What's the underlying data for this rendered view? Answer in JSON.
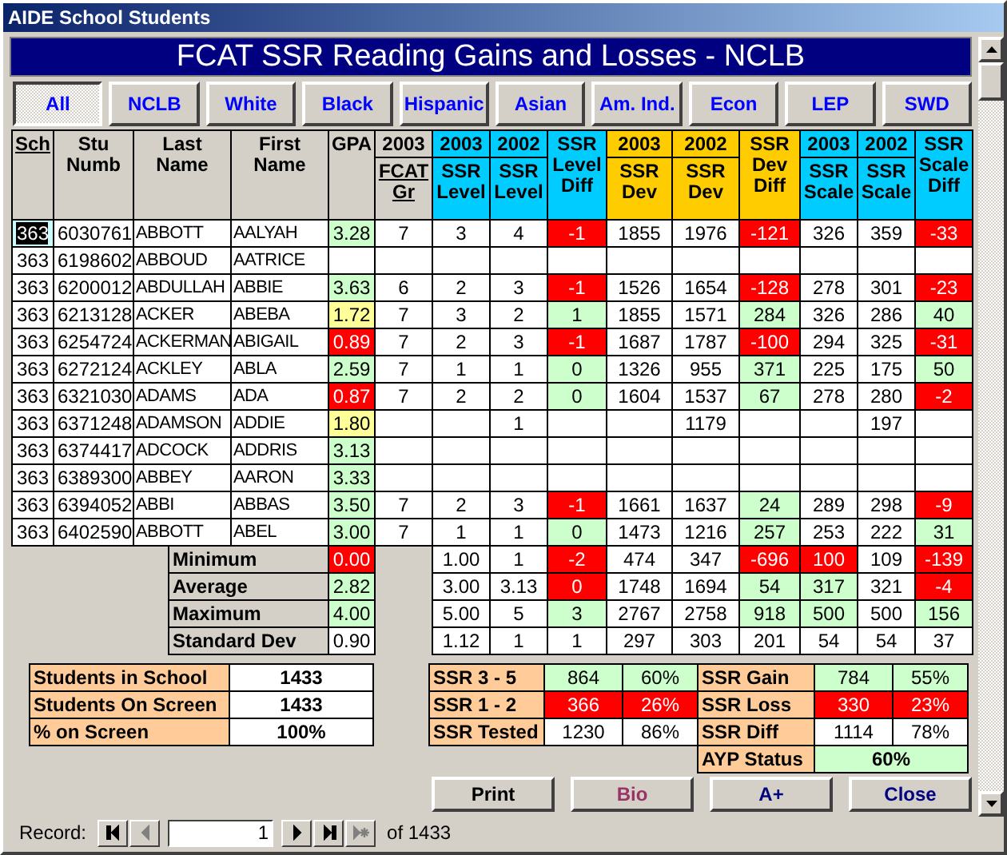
{
  "window": {
    "title": "AIDE School Students"
  },
  "banner": {
    "title": "FCAT SSR Reading Gains and Losses - NCLB"
  },
  "filters": [
    {
      "label": "All",
      "selected": true
    },
    {
      "label": "NCLB",
      "selected": false
    },
    {
      "label": "White",
      "selected": false
    },
    {
      "label": "Black",
      "selected": false
    },
    {
      "label": "Hispanic",
      "selected": false
    },
    {
      "label": "Asian",
      "selected": false
    },
    {
      "label": "Am. Ind.",
      "selected": false
    },
    {
      "label": "Econ",
      "selected": false
    },
    {
      "label": "LEP",
      "selected": false
    },
    {
      "label": "SWD",
      "selected": false
    }
  ],
  "table": {
    "columns": [
      {
        "label": "Sch",
        "color": "#d4d0c8",
        "underline": true
      },
      {
        "label": "Stu Numb",
        "color": "#d4d0c8",
        "underline": false
      },
      {
        "label": "Last Name",
        "color": "#d4d0c8",
        "underline": false
      },
      {
        "label": "First Name",
        "color": "#d4d0c8",
        "underline": false
      },
      {
        "label": "GPA",
        "color": "#d4d0c8",
        "underline": false
      },
      {
        "year": "2003",
        "label": "FCAT Gr",
        "color": "#d4d0c8",
        "underline": true
      },
      {
        "year": "2003",
        "label": "SSR Level",
        "color": "#00ccff",
        "underline": false
      },
      {
        "year": "2002",
        "label": "SSR Level",
        "color": "#00ccff",
        "underline": false
      },
      {
        "label": "SSR Level Diff",
        "color": "#00ccff",
        "underline": false
      },
      {
        "year": "2003",
        "label": "SSR Dev",
        "color": "#ffcc00",
        "underline": false
      },
      {
        "year": "2002",
        "label": "SSR Dev",
        "color": "#ffcc00",
        "underline": false
      },
      {
        "label": "SSR Dev Diff",
        "color": "#ffcc00",
        "underline": false
      },
      {
        "year": "2003",
        "label": "SSR Scale",
        "color": "#00ccff",
        "underline": false
      },
      {
        "year": "2002",
        "label": "SSR Scale",
        "color": "#00ccff",
        "underline": false
      },
      {
        "label": "SSR Scale Diff",
        "color": "#00ccff",
        "underline": false
      }
    ],
    "rows": [
      {
        "selected": true,
        "cells": [
          "363",
          "6030761",
          "ABBOTT",
          "AALYAH",
          {
            "text": "3.28",
            "color": "#ccffcc"
          },
          "7",
          "3",
          "4",
          {
            "text": "-1",
            "color": "#ff0000"
          },
          "1855",
          "1976",
          {
            "text": "-121",
            "color": "#ff0000"
          },
          "326",
          "359",
          {
            "text": "-33",
            "color": "#ff0000"
          }
        ]
      },
      {
        "selected": false,
        "cells": [
          "363",
          "6198602",
          "ABBOUD",
          "AATRICE",
          null,
          null,
          null,
          null,
          null,
          null,
          null,
          null,
          null,
          null,
          null
        ]
      },
      {
        "selected": false,
        "cells": [
          "363",
          "6200012",
          "ABDULLAH",
          "ABBIE",
          {
            "text": "3.63",
            "color": "#ccffcc"
          },
          "6",
          "2",
          "3",
          {
            "text": "-1",
            "color": "#ff0000"
          },
          "1526",
          "1654",
          {
            "text": "-128",
            "color": "#ff0000"
          },
          "278",
          "301",
          {
            "text": "-23",
            "color": "#ff0000"
          }
        ]
      },
      {
        "selected": false,
        "cells": [
          "363",
          "6213128",
          "ACKER",
          "ABEBA",
          {
            "text": "1.72",
            "color": "#ffff99"
          },
          "7",
          "3",
          "2",
          {
            "text": "1",
            "color": "#ccffcc"
          },
          "1855",
          "1571",
          {
            "text": "284",
            "color": "#ccffcc"
          },
          "326",
          "286",
          {
            "text": "40",
            "color": "#ccffcc"
          }
        ]
      },
      {
        "selected": false,
        "cells": [
          "363",
          "6254724",
          "ACKERMAN",
          "ABIGAIL",
          {
            "text": "0.89",
            "color": "#ff0000"
          },
          "7",
          "2",
          "3",
          {
            "text": "-1",
            "color": "#ff0000"
          },
          "1687",
          "1787",
          {
            "text": "-100",
            "color": "#ff0000"
          },
          "294",
          "325",
          {
            "text": "-31",
            "color": "#ff0000"
          }
        ]
      },
      {
        "selected": false,
        "cells": [
          "363",
          "6272124",
          "ACKLEY",
          "ABLA",
          {
            "text": "2.59",
            "color": "#ccffcc"
          },
          "7",
          "1",
          "1",
          {
            "text": "0",
            "color": "#ccffcc"
          },
          "1326",
          "955",
          {
            "text": "371",
            "color": "#ccffcc"
          },
          "225",
          "175",
          {
            "text": "50",
            "color": "#ccffcc"
          }
        ]
      },
      {
        "selected": false,
        "cells": [
          "363",
          "6321030",
          "ADAMS",
          "ADA",
          {
            "text": "0.87",
            "color": "#ff0000"
          },
          "7",
          "2",
          "2",
          {
            "text": "0",
            "color": "#ccffcc"
          },
          "1604",
          "1537",
          {
            "text": "67",
            "color": "#ccffcc"
          },
          "278",
          "280",
          {
            "text": "-2",
            "color": "#ff0000"
          }
        ]
      },
      {
        "selected": false,
        "cells": [
          "363",
          "6371248",
          "ADAMSON",
          "ADDIE",
          {
            "text": "1.80",
            "color": "#ffff99"
          },
          null,
          null,
          "1",
          null,
          null,
          "1179",
          null,
          null,
          "197",
          null
        ]
      },
      {
        "selected": false,
        "cells": [
          "363",
          "6374417",
          "ADCOCK",
          "ADDRIS",
          {
            "text": "3.13",
            "color": "#ccffcc"
          },
          null,
          null,
          null,
          null,
          null,
          null,
          null,
          null,
          null,
          null
        ]
      },
      {
        "selected": false,
        "cells": [
          "363",
          "6389300",
          "ABBEY",
          "AARON",
          {
            "text": "3.33",
            "color": "#ccffcc"
          },
          null,
          null,
          null,
          null,
          null,
          null,
          null,
          null,
          null,
          null
        ]
      },
      {
        "selected": false,
        "cells": [
          "363",
          "6394052",
          "ABBI",
          "ABBAS",
          {
            "text": "3.50",
            "color": "#ccffcc"
          },
          "7",
          "2",
          "3",
          {
            "text": "-1",
            "color": "#ff0000"
          },
          "1661",
          "1637",
          {
            "text": "24",
            "color": "#ccffcc"
          },
          "289",
          "298",
          {
            "text": "-9",
            "color": "#ff0000"
          }
        ]
      },
      {
        "selected": false,
        "cells": [
          "363",
          "6402590",
          "ABBOTT",
          "ABEL",
          {
            "text": "3.00",
            "color": "#ccffcc"
          },
          "7",
          "1",
          "1",
          {
            "text": "0",
            "color": "#ccffcc"
          },
          "1473",
          "1216",
          {
            "text": "257",
            "color": "#ccffcc"
          },
          "253",
          "222",
          {
            "text": "31",
            "color": "#ccffcc"
          }
        ]
      }
    ]
  },
  "stats": [
    {
      "label": "Minimum",
      "gpa": {
        "text": "0.00",
        "color": "#ff0000"
      },
      "values": [
        "1.00",
        "1",
        {
          "text": "-2",
          "color": "#ff0000"
        },
        "474",
        "347",
        {
          "text": "-696",
          "color": "#ff0000"
        },
        {
          "text": "100",
          "color": "#ff0000"
        },
        "109",
        {
          "text": "-139",
          "color": "#ff0000"
        }
      ]
    },
    {
      "label": "Average",
      "gpa": {
        "text": "2.82",
        "color": "#ccffcc"
      },
      "values": [
        "3.00",
        "3.13",
        {
          "text": "0",
          "color": "#ff0000"
        },
        "1748",
        "1694",
        {
          "text": "54",
          "color": "#ccffcc"
        },
        {
          "text": "317",
          "color": "#ccffcc"
        },
        "321",
        {
          "text": "-4",
          "color": "#ff0000"
        }
      ]
    },
    {
      "label": "Maximum",
      "gpa": {
        "text": "4.00",
        "color": "#ccffcc"
      },
      "values": [
        "5.00",
        "5",
        {
          "text": "3",
          "color": "#ccffcc"
        },
        "2767",
        "2758",
        {
          "text": "918",
          "color": "#ccffcc"
        },
        {
          "text": "500",
          "color": "#ccffcc"
        },
        "500",
        {
          "text": "156",
          "color": "#ccffcc"
        }
      ]
    },
    {
      "label": "Standard Dev",
      "gpa": "0.90",
      "values": [
        "1.12",
        "1",
        "1",
        "297",
        "303",
        "201",
        "54",
        "54",
        "37"
      ]
    }
  ],
  "school_counts": [
    {
      "label": "Students in School",
      "value": "1433"
    },
    {
      "label": "Students On Screen",
      "value": "1433"
    },
    {
      "label": "% on Screen",
      "value": "100%"
    }
  ],
  "ssr_levels": [
    {
      "label": "SSR 3 - 5",
      "count": {
        "text": "864",
        "color": "#ccffcc"
      },
      "percent": {
        "text": "60%",
        "color": "#ccffcc"
      }
    },
    {
      "label": "SSR 1 - 2",
      "count": {
        "text": "366",
        "color": "#ff0000"
      },
      "percent": {
        "text": "26%",
        "color": "#ff0000"
      }
    },
    {
      "label": "SSR Tested",
      "count": "1230",
      "percent": "86%"
    }
  ],
  "ssr_changes": [
    {
      "label": "SSR Gain",
      "count": {
        "text": "784",
        "color": "#ccffcc"
      },
      "percent": {
        "text": "55%",
        "color": "#ccffcc"
      }
    },
    {
      "label": "SSR Loss",
      "count": {
        "text": "330",
        "color": "#ff0000"
      },
      "percent": {
        "text": "23%",
        "color": "#ff0000"
      }
    },
    {
      "label": "SSR Diff",
      "count": "1114",
      "percent": "78%"
    }
  ],
  "ayp": {
    "label": "AYP Status",
    "value": {
      "text": "60%",
      "color": "#ccffcc"
    }
  },
  "buttons": [
    {
      "label": "Print",
      "color": "#000000"
    },
    {
      "label": "Bio",
      "color": "#993366"
    },
    {
      "label": "A+",
      "color": "#000080"
    },
    {
      "label": "Close",
      "color": "#000080"
    }
  ],
  "record": {
    "label": "Record:",
    "value": "1",
    "total": "of 1433",
    "nav": [
      {
        "kind": "first",
        "disabled": false
      },
      {
        "kind": "prev",
        "disabled": true
      },
      {
        "kind": "next",
        "disabled": false
      },
      {
        "kind": "last",
        "disabled": false
      },
      {
        "kind": "new",
        "disabled": true
      }
    ]
  }
}
